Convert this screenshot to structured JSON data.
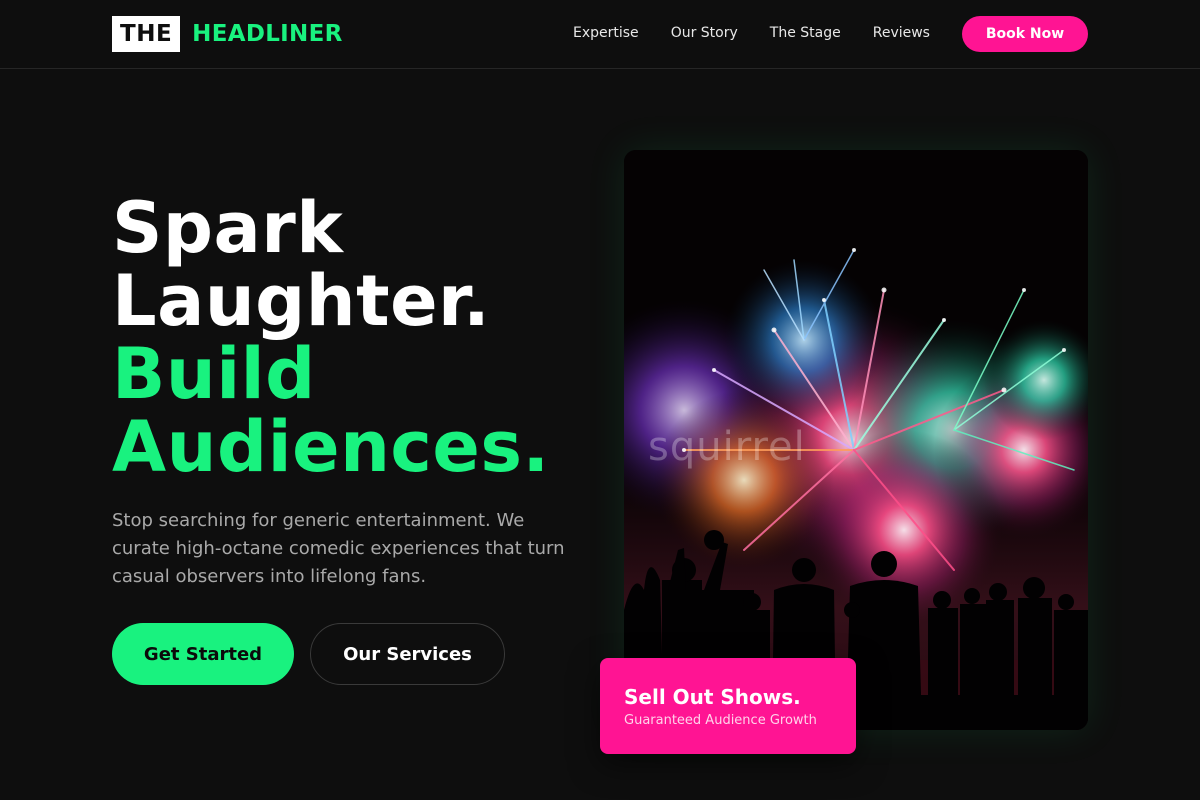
{
  "header": {
    "logo_box": "THE",
    "logo_word": "HEADLINER",
    "nav": [
      "Expertise",
      "Our Story",
      "The Stage",
      "Reviews"
    ],
    "cta": "Book Now"
  },
  "hero": {
    "title_lines": [
      "Spark",
      "Laughter."
    ],
    "title_accent_lines": [
      "Build",
      "Audiences."
    ],
    "subtitle": "Stop searching for generic entertainment. We curate high-octane comedic experiences that turn casual observers into lifelong fans.",
    "primary_button": "Get Started",
    "secondary_button": "Our Services",
    "image_watermark": "squirrel",
    "badge": {
      "title": "Sell Out Shows.",
      "subtitle": "Guaranteed Audience Growth"
    }
  },
  "colors": {
    "background": "#0e0e0e",
    "accent_green": "#19f27f",
    "accent_pink": "#ff1493",
    "muted_text": "#a9a9a9"
  }
}
